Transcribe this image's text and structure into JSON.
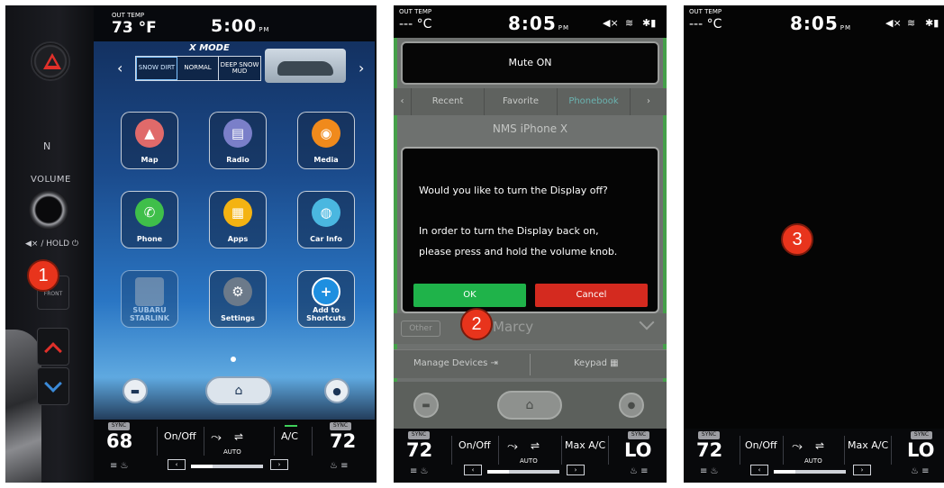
{
  "panel1": {
    "out_temp_label": "OUT TEMP",
    "out_temp_value": "73 °F",
    "time": "5:00",
    "time_suffix": "PM",
    "xmode_label": "X MODE",
    "xmode_options": [
      "SNOW DIRT",
      "NORMAL",
      "DEEP SNOW MUD"
    ],
    "volume_label": "VOLUME",
    "mute_label": "◀× / HOLD ⏻",
    "front_label": "FRONT",
    "apps": [
      {
        "label": "Map",
        "color": "#e06a6a",
        "glyph": "▲"
      },
      {
        "label": "Radio",
        "color": "#7a7fc9",
        "glyph": "▤"
      },
      {
        "label": "Media",
        "color": "#f08a1c",
        "glyph": "◉"
      },
      {
        "label": "Phone",
        "color": "#3fbf4a",
        "glyph": "✆"
      },
      {
        "label": "Apps",
        "color": "#f4b312",
        "glyph": "▦"
      },
      {
        "label": "Car Info",
        "color": "#4ab7e0",
        "glyph": "◍"
      },
      {
        "label": "SUBARU STARLINK",
        "color": "#9a9ea4",
        "glyph": ""
      },
      {
        "label": "Settings",
        "color": "#6c7a8a",
        "glyph": "⚙"
      },
      {
        "label": "Add to Shortcuts",
        "color": "#1e8fe0",
        "glyph": "+"
      }
    ],
    "climate": {
      "sync": "SYNC",
      "left_temp": "68",
      "right_temp": "72",
      "on_off": "On/Off",
      "auto": "AUTO",
      "ac": "A/C"
    },
    "marker": "1"
  },
  "panel2": {
    "out_temp_label": "OUT TEMP",
    "out_temp_value": "--- °C",
    "time": "8:05",
    "time_suffix": "PM",
    "mute_banner": "Mute ON",
    "tabs": [
      "Recent",
      "Favorite",
      "Phonebook"
    ],
    "device_name": "NMS iPhone X",
    "dialog_question": "Would you like to turn the Display off?",
    "dialog_line1": "In order to turn the Display back on,",
    "dialog_line2": "please press and hold the volume knob.",
    "ok_label": "OK",
    "cancel_label": "Cancel",
    "contact_type": "Other",
    "contact_name": "Marcy",
    "manage_devices": "Manage Devices",
    "keypad": "Keypad",
    "climate": {
      "sync": "SYNC",
      "left_temp": "72",
      "right_temp": "LO",
      "on_off": "On/Off",
      "auto": "AUTO",
      "ac": "Max A/C"
    },
    "marker": "2"
  },
  "panel3": {
    "out_temp_label": "OUT TEMP",
    "out_temp_value": "--- °C",
    "time": "8:05",
    "time_suffix": "PM",
    "climate": {
      "sync": "SYNC",
      "left_temp": "72",
      "right_temp": "LO",
      "on_off": "On/Off",
      "auto": "AUTO",
      "ac": "Max A/C"
    },
    "marker": "3"
  }
}
